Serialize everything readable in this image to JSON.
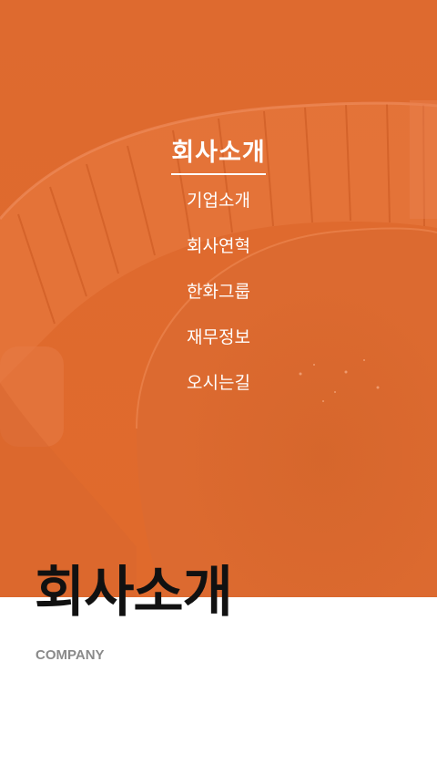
{
  "theme": {
    "accent": "#e0692e",
    "text_dark": "#111111",
    "text_muted": "#8a8a8a",
    "menu_text": "#ffffff"
  },
  "hero": {
    "background_image": "spiral-staircase-photo"
  },
  "nav": {
    "title": "회사소개",
    "items": [
      {
        "label": "기업소개"
      },
      {
        "label": "회사연혁"
      },
      {
        "label": "한화그룹"
      },
      {
        "label": "재무정보"
      },
      {
        "label": "오시는길"
      }
    ]
  },
  "page": {
    "title": "회사소개",
    "subtitle": "COMPANY"
  }
}
